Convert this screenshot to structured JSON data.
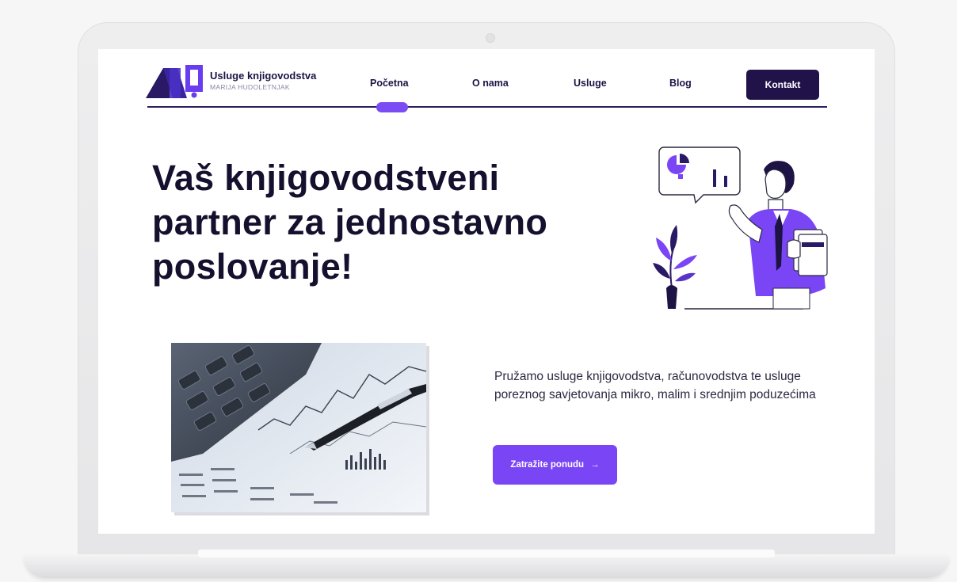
{
  "header": {
    "brand_title": "Usluge knjigovodstva",
    "brand_subtitle": "MARIJA HUDOLETNJAK",
    "nav": {
      "home": "Početna",
      "about": "O nama",
      "services": "Usluge",
      "blog": "Blog"
    },
    "contact_label": "Kontakt",
    "active_item": "home"
  },
  "hero": {
    "title": "Vaš knjigovodstveni partner za jednostavno poslovanje!",
    "description": "Pružamo usluge knjigovodstva, računovodstva te usluge poreznog savjetovanja mikro, malim i srednjim poduzećima",
    "cta_label": "Zatražite ponudu",
    "cta_arrow": "→"
  },
  "colors": {
    "navy": "#1e1345",
    "accent_purple": "#7a45f5",
    "dark_button": "#21124a"
  },
  "icons": [
    "logo-mark",
    "presenter-illustration",
    "calculator-chart-photo",
    "arrow-right-icon"
  ]
}
